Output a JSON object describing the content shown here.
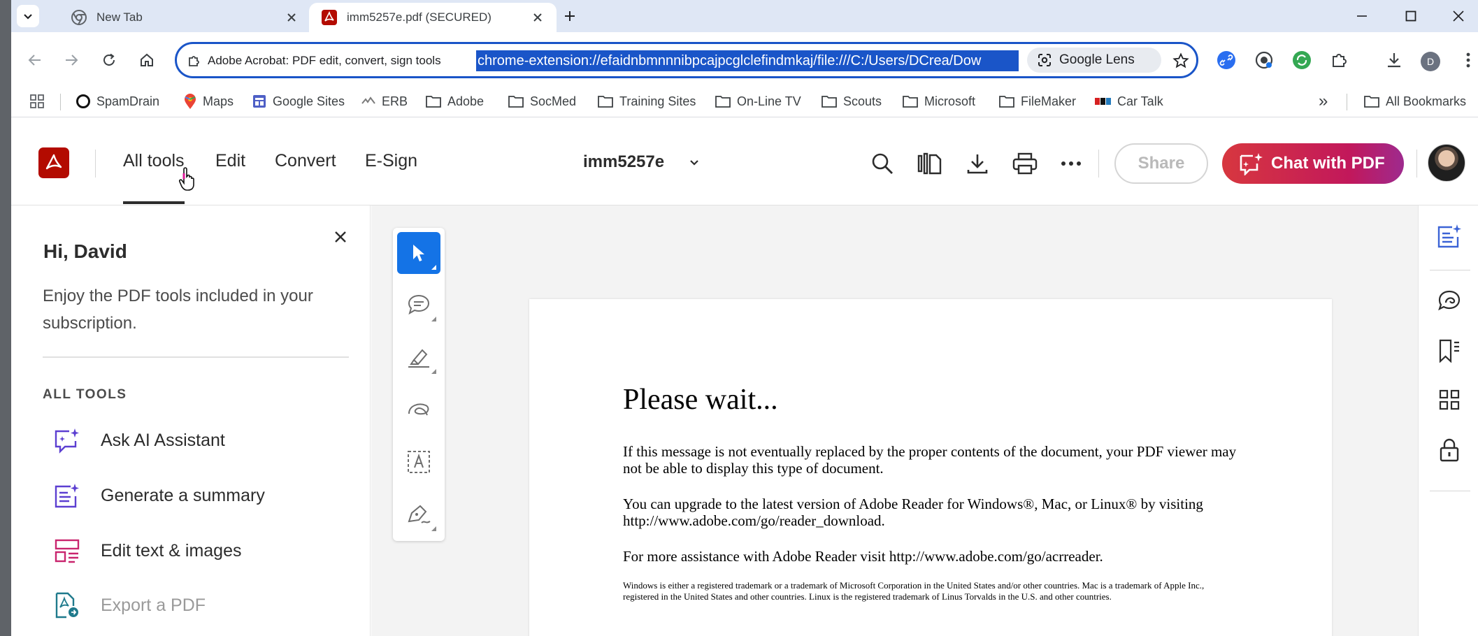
{
  "browser": {
    "tabs": [
      {
        "title": "New Tab",
        "icon": "chrome-icon"
      },
      {
        "title": "imm5257e.pdf (SECURED)",
        "icon": "acrobat-icon"
      }
    ],
    "site_chip": "Adobe Acrobat: PDF edit, convert, sign tools",
    "url": "chrome-extension://efaidnbmnnnibpcajpcglclefindmkaj/file:///C:/Users/DCrea/Dow",
    "lens_label": "Google Lens",
    "profile_initial": "D"
  },
  "bookmarks": [
    {
      "label": "SpamDrain",
      "icon": "spamdrain-icon"
    },
    {
      "label": "Maps",
      "icon": "maps-pin-icon"
    },
    {
      "label": "Google Sites",
      "icon": "google-sites-icon"
    },
    {
      "label": "ERB",
      "icon": "erb-icon"
    },
    {
      "label": "Adobe",
      "icon": "folder-icon"
    },
    {
      "label": "SocMed",
      "icon": "folder-icon"
    },
    {
      "label": "Training Sites",
      "icon": "folder-icon"
    },
    {
      "label": "On-Line TV",
      "icon": "folder-icon"
    },
    {
      "label": "Scouts",
      "icon": "folder-icon"
    },
    {
      "label": "Microsoft",
      "icon": "folder-icon"
    },
    {
      "label": "FileMaker",
      "icon": "folder-icon"
    },
    {
      "label": "Car Talk",
      "icon": "npr-icon"
    }
  ],
  "bookmarks_overflow": "»",
  "all_bookmarks": "All Bookmarks",
  "acrobat": {
    "nav": [
      "All tools",
      "Edit",
      "Convert",
      "E-Sign"
    ],
    "active_nav": "All tools",
    "doc_name": "imm5257e",
    "share_label": "Share",
    "chat_label": "Chat with PDF",
    "colors": {
      "brand_red": "#b30b00",
      "active_blue": "#1473e6",
      "ai_purple": "#5c3fd1",
      "edit_pink": "#c9256e",
      "export_teal": "#1f7a8c"
    }
  },
  "panel": {
    "greeting": "Hi, David",
    "subtext": "Enjoy the PDF tools included in your subscription.",
    "section_label": "ALL TOOLS",
    "tools": [
      {
        "label": "Ask AI Assistant",
        "icon": "ai-assistant-icon",
        "muted": false
      },
      {
        "label": "Generate a summary",
        "icon": "summary-icon",
        "muted": false
      },
      {
        "label": "Edit text & images",
        "icon": "edit-text-images-icon",
        "muted": false
      },
      {
        "label": "Export a PDF",
        "icon": "export-pdf-icon",
        "muted": true
      }
    ]
  },
  "pdf": {
    "title": "Please wait...",
    "para1": "If this message is not eventually replaced by the proper contents of the document, your PDF viewer may not be able to display this type of document.",
    "para2": "You can upgrade to the latest version of Adobe Reader for Windows®, Mac, or Linux® by visiting  http://www.adobe.com/go/reader_download.",
    "para3": "For more assistance with Adobe Reader visit  http://www.adobe.com/go/acrreader.",
    "fineprint": "Windows is either a registered trademark or a trademark of Microsoft Corporation in the United States and/or other countries. Mac is a trademark of Apple Inc., registered in the United States and other countries. Linux is the registered trademark of Linus Torvalds in the U.S. and other countries."
  }
}
